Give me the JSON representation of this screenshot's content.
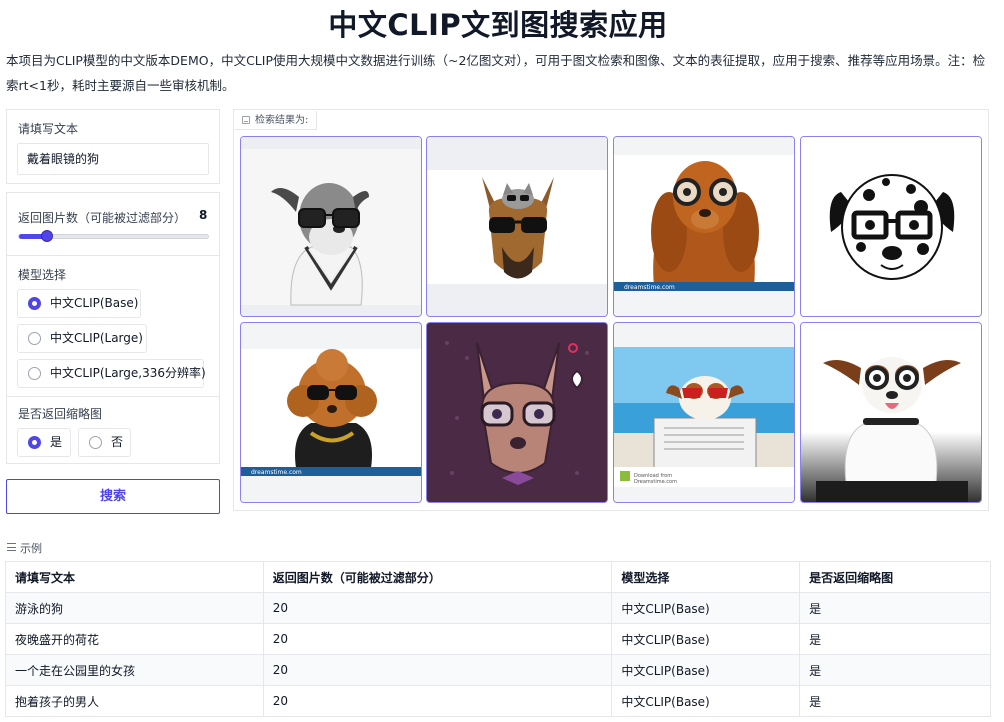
{
  "page": {
    "title": "中文CLIP文到图搜索应用",
    "description": "本项目为CLIP模型的中文版本DEMO，中文CLIP使用大规模中文数据进行训练（~2亿图文对），可用于图文检索和图像、文本的表征提取，应用于搜索、推荐等应用场景。注：检索rt<1秒，耗时主要源自一些审核机制。"
  },
  "query": {
    "label": "请填写文本",
    "value": "戴着眼镜的狗"
  },
  "count": {
    "label": "返回图片数（可能被过滤部分）",
    "value": "8",
    "fraction": 0.15
  },
  "model": {
    "label": "模型选择",
    "options": [
      "中文CLIP(Base)",
      "中文CLIP(Large)",
      "中文CLIP(Large,336分辨率)"
    ],
    "selected": "中文CLIP(Base)"
  },
  "thumbnail": {
    "label": "是否返回缩略图",
    "options": [
      "是",
      "否"
    ],
    "selected": "是"
  },
  "search_button": "搜索",
  "gallery": {
    "label": "检索结果为:",
    "images": [
      "schnauzer-glasses-photo",
      "great-dane-cat-sunglasses-photo",
      "spaniel-goggles-photo",
      "dalmatian-glasses-illustration",
      "poodle-sunglasses-photo",
      "chihuahua-glasses-illustration",
      "jack-russell-newspaper-photo",
      "jack-russell-laptop-photo"
    ]
  },
  "examples": {
    "label": "示例",
    "headers": [
      "请填写文本",
      "返回图片数（可能被过滤部分）",
      "模型选择",
      "是否返回缩略图"
    ],
    "rows": [
      [
        "游泳的狗",
        "20",
        "中文CLIP(Base)",
        "是"
      ],
      [
        "夜晚盛开的荷花",
        "20",
        "中文CLIP(Base)",
        "是"
      ],
      [
        "一个走在公园里的女孩",
        "20",
        "中文CLIP(Base)",
        "是"
      ],
      [
        "抱着孩子的男人",
        "20",
        "中文CLIP(Base)",
        "是"
      ]
    ]
  },
  "colors": {
    "accent": "#4f46e5",
    "tile_border": "#8b80f0",
    "border": "#e5e7eb"
  }
}
